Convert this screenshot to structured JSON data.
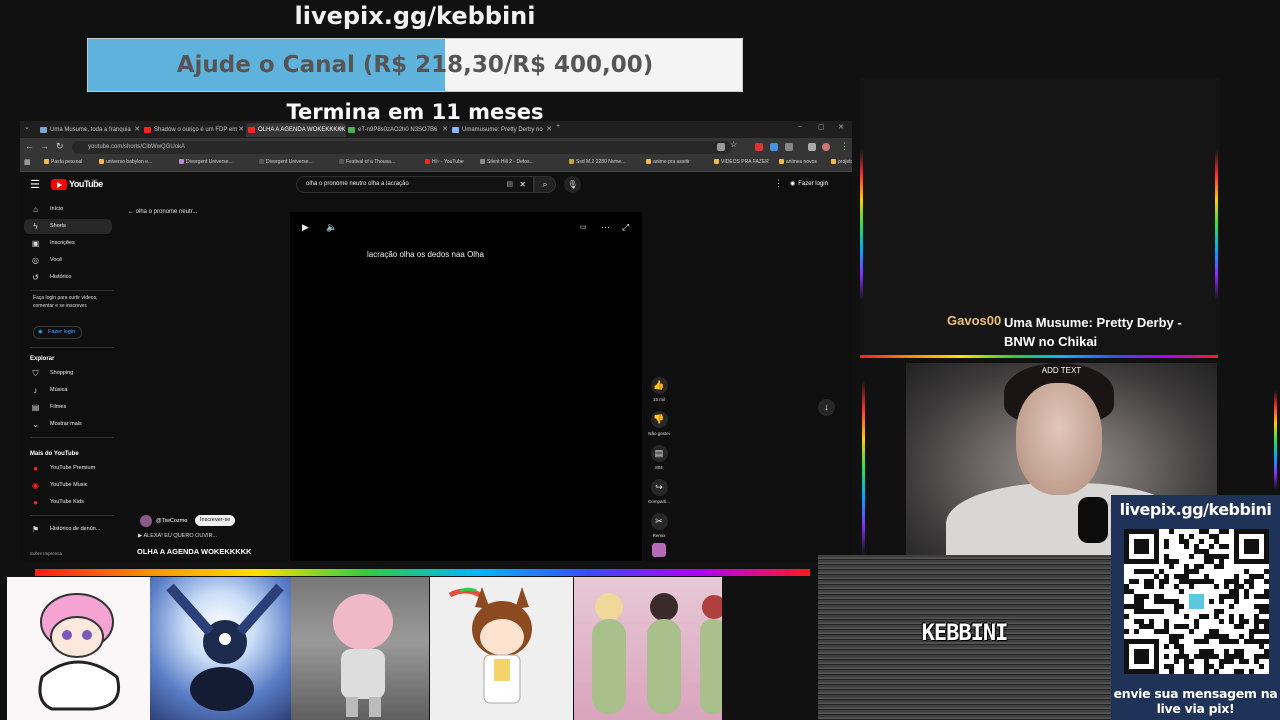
{
  "overlay": {
    "banner_url": "livepix.gg/kebbini",
    "goal_text": "Ajude o Canal (R$ 218,30/R$ 400,00)",
    "goal_progress": 0.5458,
    "ends_text": "Termina em 11 meses"
  },
  "browser": {
    "tabs": [
      {
        "title": "Uma Musume, toda a franquia",
        "icon": "tab-favicon",
        "active": false
      },
      {
        "title": "Shadow o ouriço é um FDP em",
        "icon": "youtube-icon",
        "active": false
      },
      {
        "title": "OLHA A AGENDA WOKEKKKKK",
        "icon": "youtube-icon",
        "active": true
      },
      {
        "title": "eT-n9P8s0zAO2h0 N3SO7B6",
        "icon": "tab-favicon",
        "active": false
      },
      {
        "title": "Umamusume: Pretty Derby no",
        "icon": "tab-favicon",
        "active": false
      }
    ],
    "new_tab": "+",
    "address": "youtube.com/shorts/ClbWwQGUokA",
    "bookmarks": [
      "Pasta pessoal",
      "universo babylon e...",
      "Divergent Universe...",
      "Divergent Universe...",
      "Festival of a Thousa...",
      "Hi~ - YouTube",
      "Silent Hill 2 - Detos...",
      "Ssd M.2 2280 Nvme...",
      "anime pra assitir",
      "VIDEOS PRA FAZER",
      "animes novos",
      "projeto rpg"
    ]
  },
  "youtube": {
    "logo_text": "YouTube",
    "logo_sup": "BR",
    "search_query": "olha o pronome neutro olha a lacração",
    "login_label": "Fazer login",
    "sidebar": {
      "main": [
        {
          "label": "Início",
          "icon": "home-icon"
        },
        {
          "label": "Shorts",
          "icon": "shorts-icon",
          "selected": true
        },
        {
          "label": "Inscrições",
          "icon": "subscriptions-icon"
        },
        {
          "label": "Você",
          "icon": "you-icon"
        },
        {
          "label": "Histórico",
          "icon": "history-icon"
        }
      ],
      "login_note": "Faça login para curtir vídeos, comentar e se inscrever.",
      "login_button": "Fazer login",
      "explore_heading": "Explorar",
      "explore": [
        {
          "label": "Shopping",
          "icon": "shopping-icon"
        },
        {
          "label": "Música",
          "icon": "music-icon"
        },
        {
          "label": "Filmes",
          "icon": "film-icon"
        },
        {
          "label": "Mostrar mais",
          "icon": "chevron-down-icon"
        }
      ],
      "more_heading": "Mais do YouTube",
      "more": [
        {
          "label": "YouTube Premium",
          "icon": "youtube-premium-icon"
        },
        {
          "label": "YouTube Music",
          "icon": "youtube-music-icon"
        },
        {
          "label": "YouTube Kids",
          "icon": "youtube-kids-icon"
        }
      ],
      "report_history": "Histórico de denún...",
      "footer": "Sobre   Imprensa"
    },
    "back_label": "olha o pronome neutr...",
    "short": {
      "caption": "lacração olha os dedos naa Olha",
      "channel": "@TiwCozmo",
      "subscribe": "Inscrever-se",
      "music": "ALEXA! EU QUERO OUVIR...",
      "title": "OLHA A AGENDA WOKEKKKKK",
      "actions": [
        {
          "label": "15 mil",
          "icon": "thumbs-up-icon"
        },
        {
          "label": "Não gostei",
          "icon": "thumbs-down-icon"
        },
        {
          "label": "804",
          "icon": "comment-icon"
        },
        {
          "label": "Comparti...",
          "icon": "share-icon"
        },
        {
          "label": "Remix",
          "icon": "remix-icon"
        }
      ]
    }
  },
  "stream": {
    "now_playing_user": "Gavos00",
    "now_playing_song": "Uma Musume: Pretty Derby - BNW no Chikai",
    "webcam_label": "ADD TEXT",
    "pix_url": "livepix.gg/kebbini",
    "pix_message": "envie sua mensagem na live via pix!",
    "static_name": "KEBBINI"
  }
}
